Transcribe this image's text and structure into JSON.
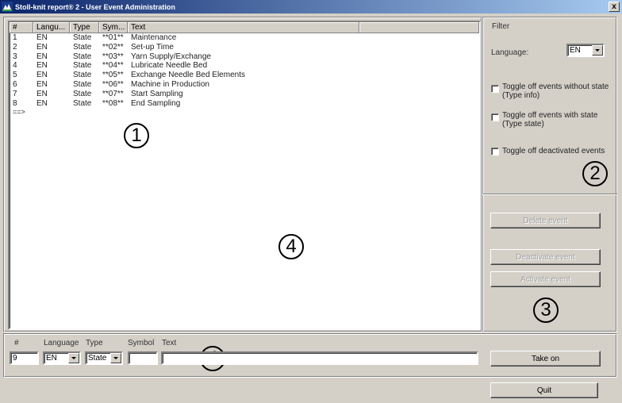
{
  "window": {
    "title": "Stoll-knit report® 2 - User Event Administration",
    "close_glyph": "x"
  },
  "list": {
    "columns": [
      "#",
      "Langu...",
      "Type",
      "Sym...",
      "Text",
      ""
    ],
    "rows": [
      {
        "num": "1",
        "lang": "EN",
        "type": "State",
        "symbol": "**01**",
        "text": "Maintenance"
      },
      {
        "num": "2",
        "lang": "EN",
        "type": "State",
        "symbol": "**02**",
        "text": "Set-up Time"
      },
      {
        "num": "3",
        "lang": "EN",
        "type": "State",
        "symbol": "**03**",
        "text": "Yarn Supply/Exchange"
      },
      {
        "num": "4",
        "lang": "EN",
        "type": "State",
        "symbol": "**04**",
        "text": "Lubricate Needle Bed"
      },
      {
        "num": "5",
        "lang": "EN",
        "type": "State",
        "symbol": "**05**",
        "text": "Exchange Needle Bed Elements"
      },
      {
        "num": "6",
        "lang": "EN",
        "type": "State",
        "symbol": "**06**",
        "text": "Machine in Production"
      },
      {
        "num": "7",
        "lang": "EN",
        "type": "State",
        "symbol": "**07**",
        "text": "Start Sampling"
      },
      {
        "num": "8",
        "lang": "EN",
        "type": "State",
        "symbol": "**08**",
        "text": "End Sampling"
      }
    ],
    "end_marker": "==>"
  },
  "filter": {
    "title": "Filter",
    "language_label": "Language:",
    "language_value": "EN",
    "toggle_no_state": "Toggle off events without state",
    "toggle_no_state_sub": "(Type info)",
    "toggle_with_state": "Toggle off events with state",
    "toggle_with_state_sub": "(Type state)",
    "toggle_deactivated": "Toggle off deactivated events"
  },
  "actions": {
    "delete": "Delete event",
    "deactivate": "Deactivate event",
    "activate": "Activate event"
  },
  "editor": {
    "num_label": "#",
    "language_label": "Language",
    "type_label": "Type",
    "symbol_label": "Symbol",
    "text_label": "Text",
    "num_value": "9",
    "language_value": "EN",
    "type_value": "State",
    "symbol_value": "",
    "text_value": "",
    "take_on": "Take on",
    "quit": "Quit"
  },
  "annotations": {
    "a1": "1",
    "a2": "2",
    "a3": "3",
    "a4_list": "4",
    "a4_editor": "4"
  }
}
